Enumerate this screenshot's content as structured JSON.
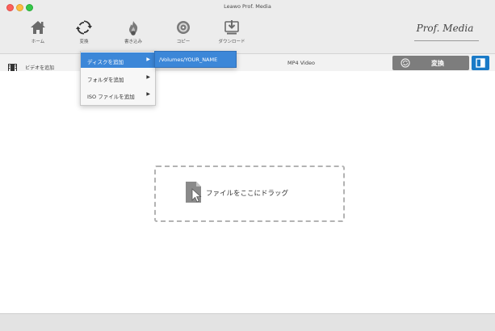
{
  "window": {
    "title": "Leawo Prof. Media"
  },
  "toolbar": {
    "items": [
      {
        "label": "ホーム",
        "icon": "home-icon"
      },
      {
        "label": "変換",
        "icon": "convert-icon"
      },
      {
        "label": "書き込み",
        "icon": "burn-icon"
      },
      {
        "label": "コピー",
        "icon": "copy-disc-icon"
      },
      {
        "label": "ダウンロード",
        "icon": "download-icon"
      }
    ],
    "brand": "Prof. Media"
  },
  "subbar": {
    "add_video_label": "ビデオを追加",
    "format_label": "MP4 Video",
    "convert_label": "変換"
  },
  "menu": {
    "items": [
      {
        "label": "ディスクを追加"
      },
      {
        "label": "フォルダを追加"
      },
      {
        "label": "ISO ファイルを追加"
      }
    ],
    "submenu_path": "/Volumes/YOUR_NAME"
  },
  "dropzone": {
    "text": "ファイルをここにドラッグ"
  },
  "colors": {
    "accent": "#3c87d8",
    "convert_button": "#7d7d7d",
    "panel_button": "#1a7ac7"
  }
}
